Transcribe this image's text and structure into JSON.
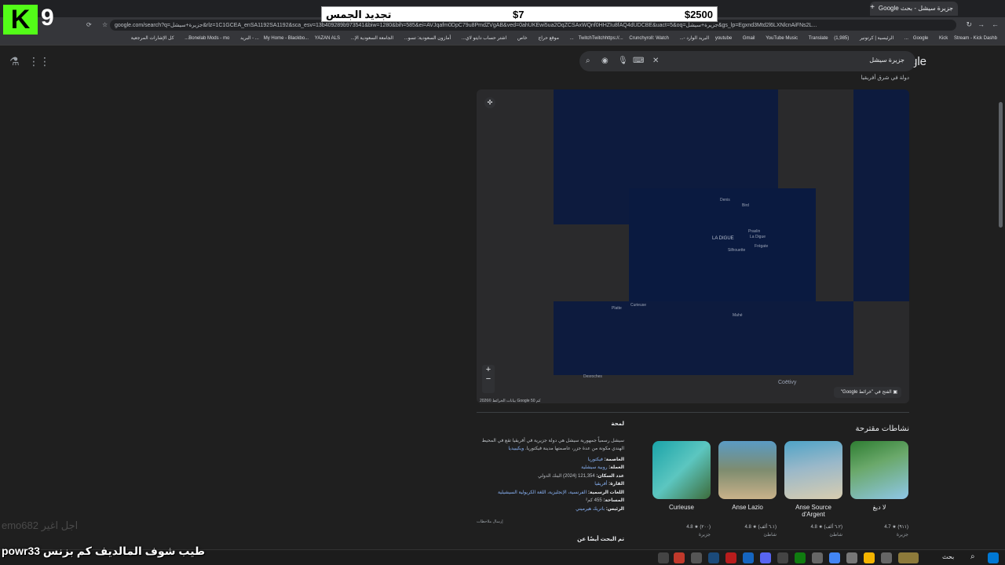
{
  "browser": {
    "tab_title": "جزيرة سيشل - بحث Google",
    "url": "google.com/search?q=جزيرة+سيشل&rlz=1C1GCEA_enSA1192SA1192&sca_esv=13b409289b973541&biw=1280&bih=585&ei=AVJqafm0DpC79u8PmdZVgAB&ved=0ahUKEwi5ua2OqZCSAxWQnf0HHZIu8fAQ4dUDCBE&uact=5&oq=جزيرة+سيشل&gs_lp=Egxnd3Mtd2l6LXNlcnAiFNs2L...",
    "bookmarks": [
      "كل الإشارات المرجعية",
      "Bonelab Mods - mo...",
      "YAZAN ALS... - البريد",
      "My Home - Blackbo...",
      "الجامعة السعودية الإ...",
      "أمازون السعودية: تسو...",
      "اشتر حساب دايتو لاي...",
      "خاص",
      "موقع حراج",
      "Crunchyroll: Watch...",
      "TwitchTwitchhttps://...",
      "(1,985) البريد الوارد -...",
      "Translate",
      "YouTube Music",
      "Gmail",
      "youtube",
      "الرئيسية | كرتونير",
      "Stream - Kick Dashb...",
      "Kick",
      "Google"
    ]
  },
  "google": {
    "logo": "Google",
    "query": "جزيرة سيشل",
    "subtitle": "دولة في شرق أفريقيا"
  },
  "map": {
    "labels": [
      "LA DIGUE",
      "Denis",
      "Bird",
      "Praslin",
      "La Digue",
      "Frégate",
      "Silhouette",
      "Mahé",
      "Curieuse",
      "Coëtivy",
      "Platte",
      "Desroches"
    ],
    "open_in_maps": "الفتح في \"خرائط Google\"",
    "scale_text": "بيانات الخرائط ©2026 Google  50 كم",
    "zoom_in": "+",
    "zoom_out": "−"
  },
  "activities": {
    "title": "نشاطات مقترحة",
    "cards": [
      {
        "name": "لا ديغ",
        "rating": "4.7 ★ (٩١١)",
        "kind": "جزيرة",
        "color_a": "#2e7d32",
        "color_b": "#8fc7e8"
      },
      {
        "name": "Anse Source d'Argent",
        "rating": "4.8 ★ (٦.٢ ألف)",
        "kind": "شاطئ",
        "color_a": "#4fa3c7",
        "color_b": "#d8cdb0"
      },
      {
        "name": "Anse Lazio",
        "rating": "4.8 ★ (٦.١ ألف)",
        "kind": "شاطئ",
        "color_a": "#5a9bc4",
        "color_b": "#c9b28a"
      },
      {
        "name": "Curieuse",
        "rating": "4.8 ★ (٢٠٠)",
        "kind": "جزيرة",
        "color_a": "#1aa3a8",
        "color_b": "#3d6b3a"
      }
    ]
  },
  "overview": {
    "title": "لمحة",
    "description": "سيشل رسمياً جمهورية سيشل هي دولة جزيرية في أفريقيا تقع في المحيط الهندي مكونة من عدة جزر، عاصمتها مدينة فيكتوريا.",
    "source": "ويكيبيديا",
    "facts": [
      {
        "key": "العاصمة:",
        "value": "فيكتوريا"
      },
      {
        "key": "العملة:",
        "value": "روبية سيشلية"
      },
      {
        "key": "عدد السكان:",
        "value": "121,354 (2024) البنك الدولي"
      },
      {
        "key": "القارة:",
        "value": "أفريقيا"
      },
      {
        "key": "اللغات الرسمية:",
        "value": "الفرنسية، الإنجليزية، اللغة الكريولية السيشيلية"
      },
      {
        "key": "المساحة:",
        "value": "455 كم²"
      },
      {
        "key": "الرئيس:",
        "value": "باتريك هيرميني"
      }
    ],
    "feedback": "إرسال ملاحظات",
    "people_also_search": "تم البحث أيضًا عن"
  },
  "stream_overlay": {
    "kick_letter": "K",
    "number": "9",
    "banner_left": "تجديد الجمس",
    "banner_mid": "$7",
    "banner_right": "$2500",
    "user_label": "emo682  اجل اغير",
    "bottom_text": "powr33  طيب شوف المالديف كم بزنس"
  },
  "taskbar": {
    "search_label": "بحث"
  }
}
